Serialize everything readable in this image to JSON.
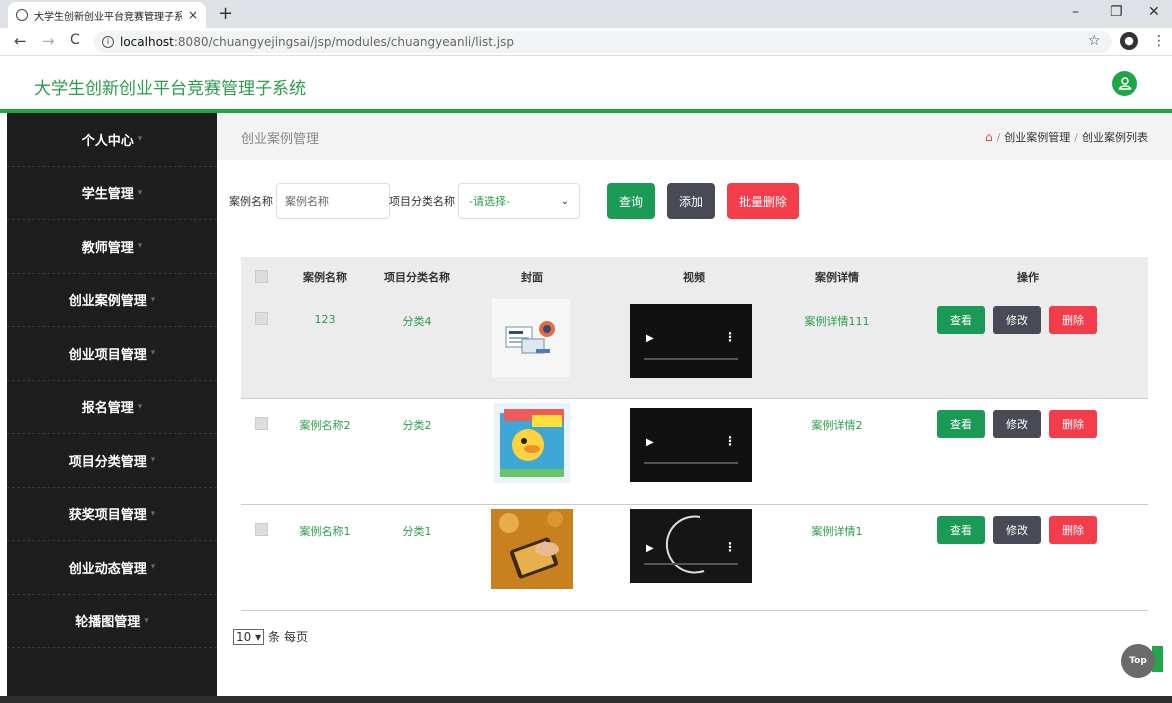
{
  "browser": {
    "tab_title": "大学生创新创业平台竞赛管理子系",
    "tab_close": "×",
    "new_tab": "+",
    "url_host": "localhost",
    "url_path": ":8080/chuangyejingsai/jsp/modules/chuangyeanli/list.jsp"
  },
  "app": {
    "title": "大学生创新创业平台竞赛管理子系统",
    "accent": "#21a63c"
  },
  "sidebar": {
    "items": [
      {
        "label": "个人中心"
      },
      {
        "label": "学生管理"
      },
      {
        "label": "教师管理"
      },
      {
        "label": "创业案例管理"
      },
      {
        "label": "创业项目管理"
      },
      {
        "label": "报名管理"
      },
      {
        "label": "项目分类管理"
      },
      {
        "label": "获奖项目管理"
      },
      {
        "label": "创业动态管理"
      },
      {
        "label": "轮播图管理"
      }
    ]
  },
  "page": {
    "title": "创业案例管理",
    "breadcrumb": [
      "创业案例管理",
      "创业案例列表"
    ],
    "sep": "/"
  },
  "search": {
    "name_label": "案例名称",
    "name_placeholder": "案例名称",
    "category_label": "项目分类名称",
    "category_selected": "-请选择-",
    "query_btn": "查询",
    "add_btn": "添加",
    "batch_delete_btn": "批量删除"
  },
  "table": {
    "headers": [
      "案例名称",
      "项目分类名称",
      "封面",
      "视频",
      "案例详情",
      "操作"
    ],
    "rows": [
      {
        "name": "123",
        "category": "分类4",
        "detail": "案例详情111"
      },
      {
        "name": "案例名称2",
        "category": "分类2",
        "detail": "案例详情2"
      },
      {
        "name": "案例名称1",
        "category": "分类1",
        "detail": "案例详情1"
      }
    ],
    "actions": {
      "view": "查看",
      "edit": "修改",
      "delete": "删除"
    }
  },
  "pager": {
    "page_size": "10",
    "suffix": "条 每页"
  },
  "top_button": "Top"
}
